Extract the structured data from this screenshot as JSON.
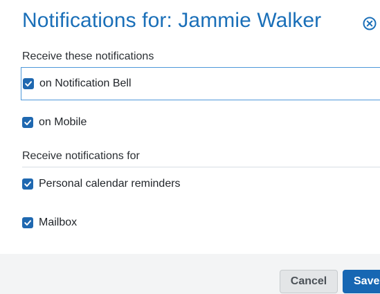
{
  "dialog": {
    "title": "Notifications for: Jammie Walker",
    "close_icon": "close-circle-icon"
  },
  "sections": [
    {
      "label": "Receive these notifications",
      "options": [
        {
          "label": "on Notification Bell",
          "checked": true
        },
        {
          "label": "on Mobile",
          "checked": true
        }
      ]
    },
    {
      "label": "Receive notifications for",
      "options": [
        {
          "label": "Personal calendar reminders",
          "checked": true
        },
        {
          "label": "Mailbox",
          "checked": true
        }
      ]
    }
  ],
  "footer": {
    "cancel_label": "Cancel",
    "save_label": "Save"
  },
  "colors": {
    "title": "#1a6fb8",
    "checkbox": "#1f68b0",
    "primary_button": "#1767b3"
  }
}
